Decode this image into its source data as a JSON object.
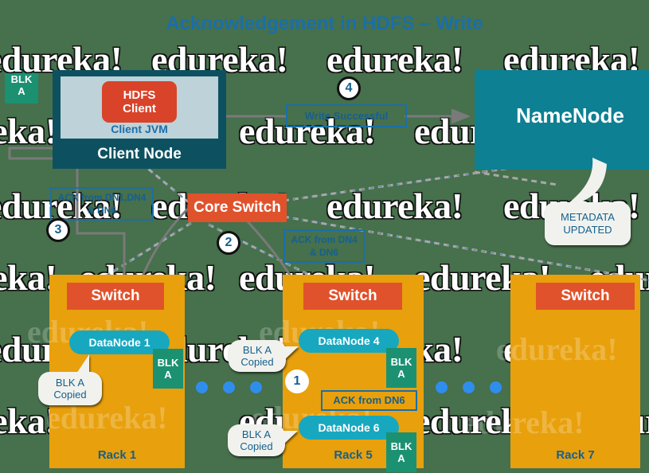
{
  "title": "Acknowledgement in HDFS – Write",
  "watermark": {
    "text": "edureka!"
  },
  "colors": {
    "background": "#47704c",
    "client_node": "#0d5160",
    "client_jvm": "#bdd2d9",
    "hdfs_client": "#d9432a",
    "namenode": "#0d8093",
    "rack": "#e8a00c",
    "switch": "#e0522c",
    "datanode": "#17a8c0",
    "block": "#1b9172",
    "accent_blue": "#15608f",
    "dot": "#2f8eec"
  },
  "client": {
    "node_label": "Client Node",
    "jvm_label": "Client JVM",
    "hdfs_client_line1": "HDFS",
    "hdfs_client_line2": "Client"
  },
  "namenode": {
    "label": "NameNode",
    "bubble_line1": "METADATA",
    "bubble_line2": "UPDATED"
  },
  "core_switch": {
    "label": "Core Switch"
  },
  "left_block": {
    "line1": "BLK",
    "line2": "A"
  },
  "labels": {
    "write_successful": "Write Successful",
    "ack_dn1_dn4_dn6": "ACK from DN1,DN4 & DN6",
    "ack_dn4_dn6": "ACK from DN4 & DN6",
    "ack_dn6": "ACK from DN6"
  },
  "badges": {
    "one": "1",
    "two": "2",
    "three": "3",
    "four": "4"
  },
  "bubbles": {
    "blk_a_copied_line1": "BLK A",
    "blk_a_copied_line2": "Copied"
  },
  "racks": [
    {
      "name": "Rack 1",
      "switch_label": "Switch",
      "datanodes": [
        {
          "label": "DataNode 1",
          "block_line1": "BLK",
          "block_line2": "A"
        }
      ]
    },
    {
      "name": "Rack 5",
      "switch_label": "Switch",
      "datanodes": [
        {
          "label": "DataNode 4",
          "block_line1": "BLK",
          "block_line2": "A"
        },
        {
          "label": "DataNode 6",
          "block_line1": "BLK",
          "block_line2": "A"
        }
      ]
    },
    {
      "name": "Rack 7",
      "switch_label": "Switch",
      "datanodes": []
    }
  ]
}
